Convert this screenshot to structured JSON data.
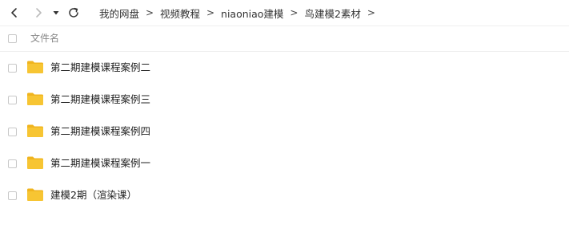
{
  "toolbar": {
    "back_icon": "chevron-left-icon",
    "forward_icon": "chevron-right-icon",
    "history_icon": "caret-down-icon",
    "refresh_icon": "refresh-icon"
  },
  "breadcrumb": {
    "items": [
      "我的网盘",
      "视频教程",
      "niaoniao建模",
      "鸟建模2素材"
    ],
    "separator": ">"
  },
  "list_header": {
    "name_label": "文件名"
  },
  "files": [
    {
      "name": "第二期建模课程案例二",
      "type": "folder"
    },
    {
      "name": "第二期建模课程案例三",
      "type": "folder"
    },
    {
      "name": "第二期建模课程案例四",
      "type": "folder"
    },
    {
      "name": "第二期建模课程案例一",
      "type": "folder"
    },
    {
      "name": "建模2期（渲染课）",
      "type": "folder"
    }
  ],
  "colors": {
    "folder": "#F7C533",
    "folder_tab": "#F0B41E",
    "divider": "#EEEEEE"
  }
}
